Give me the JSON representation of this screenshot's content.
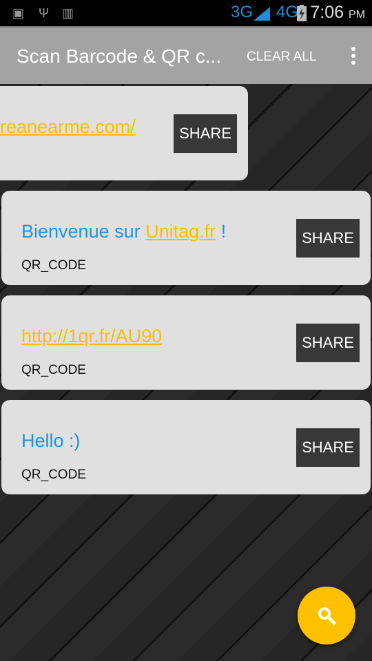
{
  "status": {
    "network1": "3G",
    "network2": "4G",
    "time": "7:06",
    "ampm": "PM"
  },
  "appbar": {
    "title": "Scan Barcode & QR c...",
    "clear_all": "CLEAR ALL"
  },
  "items": [
    {
      "text": "reanearme.com/",
      "type": "",
      "share": "SHARE"
    },
    {
      "prefix": "Bienvenue sur ",
      "link": "Unitag.fr",
      "suffix": " !",
      "type": "QR_CODE",
      "share": "SHARE"
    },
    {
      "link": "http://1qr.fr/AU90",
      "type": "QR_CODE",
      "share": "SHARE"
    },
    {
      "text": "Hello :)",
      "type": "QR_CODE",
      "share": "SHARE"
    }
  ],
  "colors": {
    "accent": "#ffc000",
    "text_blue": "#1d95e0",
    "link": "#fbbf00"
  }
}
